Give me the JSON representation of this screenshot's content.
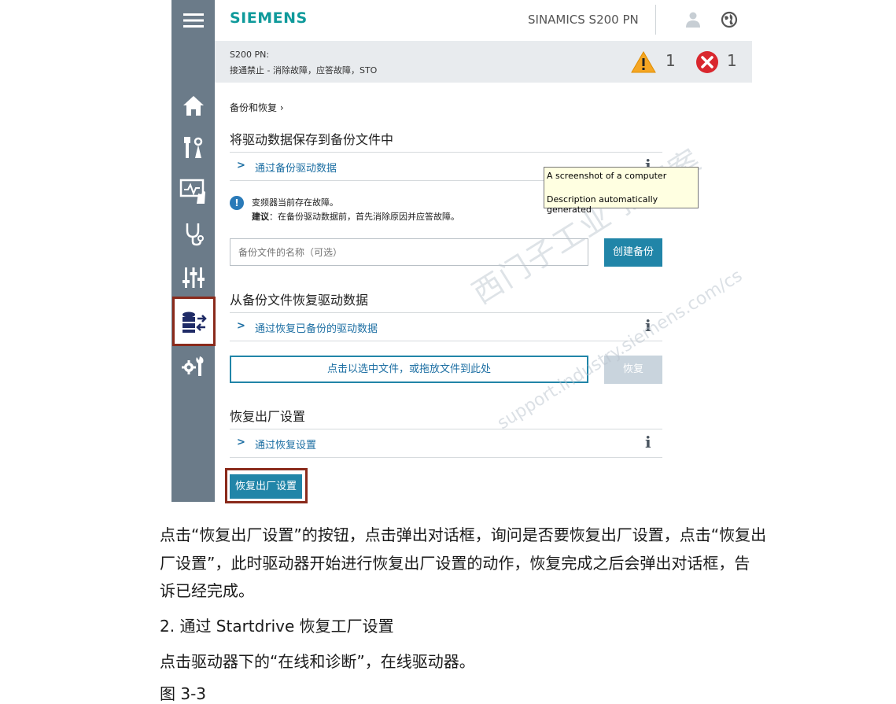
{
  "header": {
    "logo": "SIEMENS",
    "product": "SINAMICS S200 PN"
  },
  "status": {
    "device": "S200 PN:",
    "detail": "接通禁止 - 消除故障，应答故障，STO",
    "warning_count": "1",
    "error_count": "1"
  },
  "breadcrumb": "备份和恢复  ›",
  "sections": {
    "save": {
      "title": "将驱动数据保存到备份文件中",
      "expand_label": "通过备份驱动数据"
    },
    "notice": {
      "icon": "!",
      "line1": "变频器当前存在故障。",
      "line2_bold": "建议",
      "line2_rest": "：在备份驱动数据前，首先消除原因并应答故障。"
    },
    "backup_input": {
      "placeholder": "备份文件的名称（可选）",
      "button": "创建备份"
    },
    "restore": {
      "title": "从备份文件恢复驱动数据",
      "expand_label": "通过恢复已备份的驱动数据",
      "drop_zone": "点击以选中文件，或拖放文件到此处",
      "button": "恢复"
    },
    "factory": {
      "title": "恢复出厂设置",
      "expand_label": "通过恢复设置",
      "button": "恢复出厂设置"
    }
  },
  "info_glyph": "i",
  "tooltip": {
    "line1": "A screenshot of a computer",
    "line2": "Description automatically generated"
  },
  "watermark": {
    "line1": "西门子工业  找答案",
    "line2": "support.industry.siemens.com/cs"
  },
  "document": {
    "para1_line1": "点击“恢复出厂设置”的按钮，点击弹出对话框，询问是否要恢复出厂设置，点击“恢复出",
    "para1_line2": "厂设置”，此时驱动器开始进行恢复出厂设置的动作，恢复完成之后会弹出对话框，告",
    "para1_line3": "诉已经完成。",
    "heading": "2.   通过 Startdrive 恢复工厂设置",
    "para2": "点击驱动器下的“在线和诊断”，在线驱动器。",
    "figure_label": "图 3-3"
  },
  "colors": {
    "sidebar": "#6b7b89",
    "brand": "#0f9a9b",
    "accent": "#2185a8",
    "highlight_border": "#8a2a1b",
    "warning": "#f5a623",
    "error": "#d9272e"
  }
}
